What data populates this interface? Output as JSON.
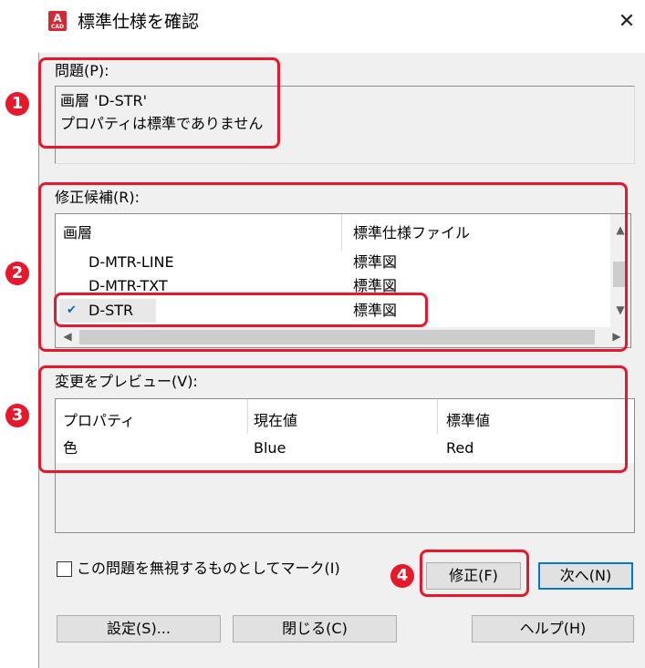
{
  "window": {
    "title": "標準仕様を確認",
    "close_glyph": "✕"
  },
  "app_icon": {
    "letter": "A",
    "sub": "CAD",
    "color": "#d02a35"
  },
  "problem": {
    "label": "問題(P):",
    "line1": "画層 'D-STR'",
    "line2": "プロパティは標準でありません"
  },
  "candidates": {
    "label": "修正候補(R):",
    "columns": [
      "画層",
      "標準仕様ファイル"
    ],
    "rows": [
      {
        "layer": "D-MTR-LINE",
        "file": "標準図"
      },
      {
        "layer": "D-MTR-TXT",
        "file": "標準図"
      },
      {
        "layer": "D-STR",
        "file": "標準図",
        "selected": true
      }
    ],
    "check_glyph": "✔",
    "scroll_up": "▲",
    "scroll_down": "▼",
    "scroll_left": "◀",
    "scroll_right": "▶"
  },
  "preview": {
    "label": "変更をプレビュー(V):",
    "columns": [
      "プロパティ",
      "現在値",
      "標準値"
    ],
    "rows": [
      {
        "property": "色",
        "current": "Blue",
        "standard": "Red"
      }
    ]
  },
  "ignore_checkbox": {
    "label": "この問題を無視するものとしてマーク(I)",
    "checked": false
  },
  "buttons": {
    "fix": "修正(F)",
    "next": "次へ(N)",
    "settings": "設定(S)...",
    "close": "閉じる(C)",
    "help": "ヘルプ(H)"
  },
  "annotations": {
    "badge1": "1",
    "badge2": "2",
    "badge3": "3",
    "badge4": "4",
    "color": "#e8182c"
  }
}
